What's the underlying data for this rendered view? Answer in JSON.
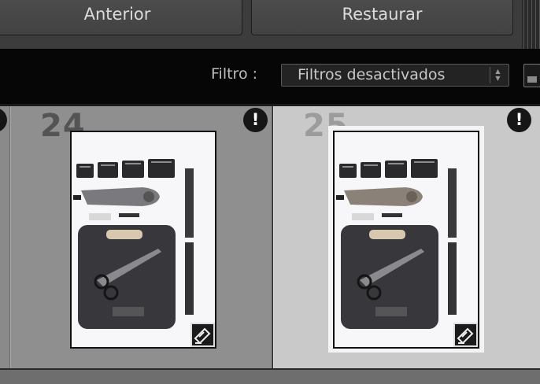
{
  "toolbar": {
    "previous_label": "Anterior",
    "reset_label": "Restaurar"
  },
  "filter": {
    "label": "Filtro :",
    "selected": "Filtros desactivados",
    "arrows": "▲▼"
  },
  "filmstrip": {
    "cells": [
      {
        "number": "24",
        "alert": "!"
      },
      {
        "number": "25",
        "alert": "!",
        "selected": true
      }
    ],
    "left_alert": "!"
  },
  "colors": {
    "selected_cell": "#c9c9c9",
    "unselected_cell": "#8f8f8f",
    "filter_bar": "#060606"
  },
  "icons": [
    "exclamation-icon",
    "adjustments-badge-icon",
    "lock-icon"
  ]
}
